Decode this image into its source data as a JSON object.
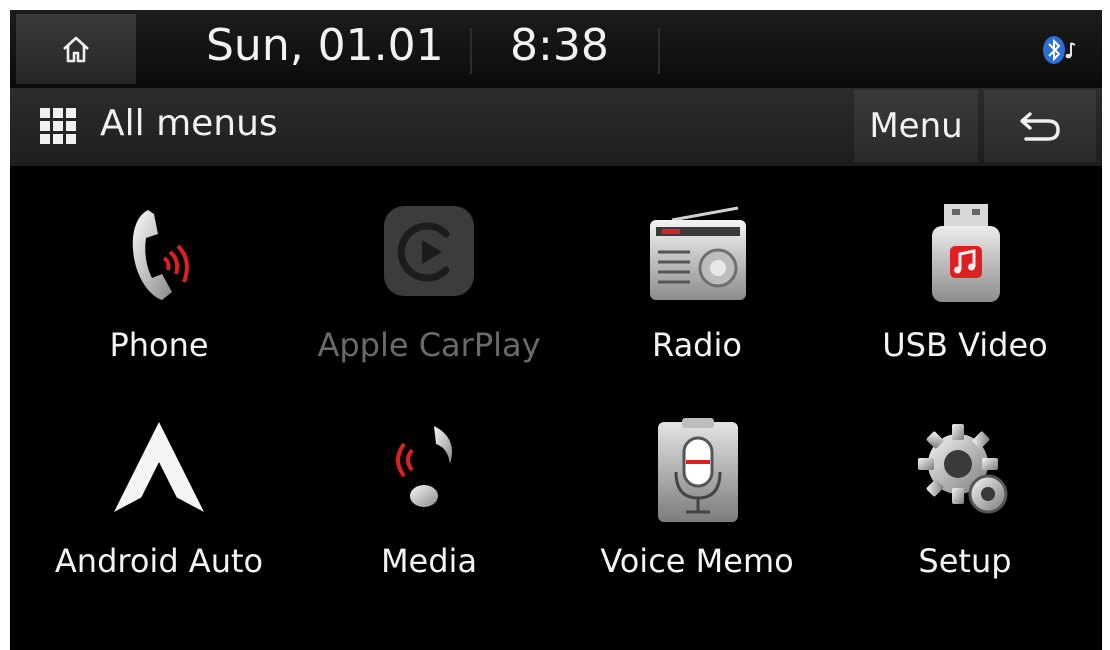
{
  "status": {
    "date": "Sun, 01.01",
    "time": "8:38",
    "icons": [
      "home-icon",
      "bluetooth-audio-icon"
    ]
  },
  "header": {
    "title": "All menus",
    "menu_label": "Menu",
    "icons": [
      "all-menus-grid-icon",
      "back-arrow-icon"
    ]
  },
  "apps": [
    {
      "label": "Phone",
      "icon": "phone-icon",
      "enabled": true
    },
    {
      "label": "Apple CarPlay",
      "icon": "carplay-icon",
      "enabled": false
    },
    {
      "label": "Radio",
      "icon": "radio-icon",
      "enabled": true
    },
    {
      "label": "USB Video",
      "icon": "usb-video-icon",
      "enabled": true
    },
    {
      "label": "Android Auto",
      "icon": "android-auto-icon",
      "enabled": true
    },
    {
      "label": "Media",
      "icon": "media-icon",
      "enabled": true
    },
    {
      "label": "Voice Memo",
      "icon": "voice-memo-icon",
      "enabled": true
    },
    {
      "label": "Setup",
      "icon": "setup-gear-icon",
      "enabled": true
    }
  ],
  "colors": {
    "background": "#000000",
    "accent_red": "#e02020",
    "disabled_text": "#6a6a6a"
  }
}
